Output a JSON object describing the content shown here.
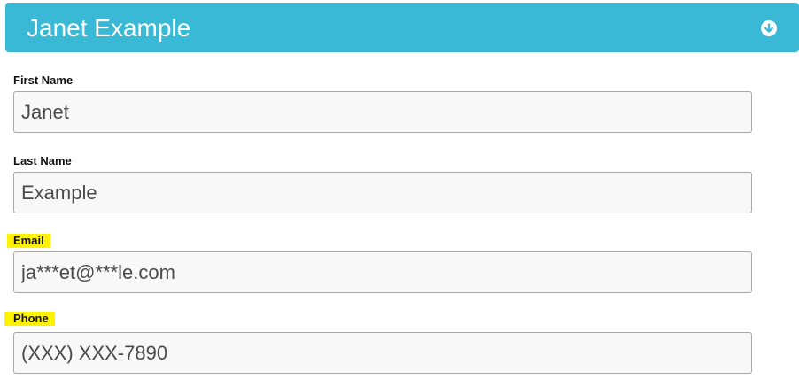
{
  "header": {
    "title": "Janet Example",
    "toggle_icon": "chevron-down-circle-icon",
    "background": "#3ab9d6"
  },
  "fields": {
    "first_name": {
      "label": "First Name",
      "value": "Janet"
    },
    "last_name": {
      "label": "Last Name",
      "value": "Example"
    },
    "email": {
      "label": "Email",
      "value": "ja***et@***le.com",
      "highlighted": true
    },
    "phone": {
      "label": "Phone",
      "value": "(XXX) XXX-7890",
      "highlighted": true
    }
  },
  "colors": {
    "highlight": "#fff200",
    "input_background": "#f8f8f8",
    "input_border": "#a8a8a8"
  }
}
